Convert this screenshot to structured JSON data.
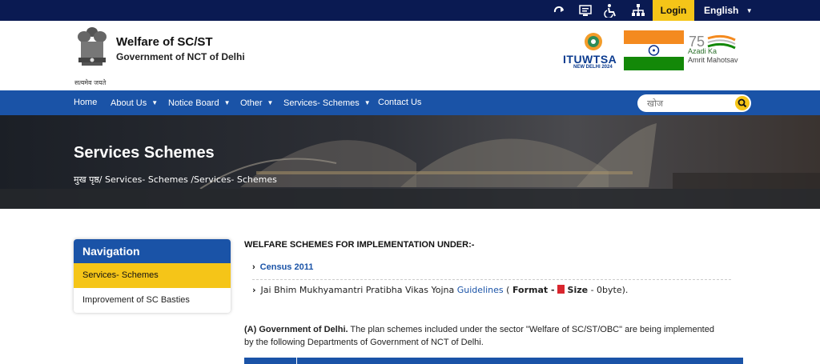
{
  "topbar": {
    "icons": [
      "skip-to-content-icon",
      "screen-reader-icon",
      "accessibility-icon",
      "sitemap-icon"
    ],
    "login_label": "Login",
    "language_label": "English"
  },
  "header": {
    "title": "Welfare of SC/ST",
    "subtitle": "Government of NCT of Delhi",
    "emblem_text": "सत्यमेव जयते",
    "itu_name": "ITUWTSA",
    "itu_sub": "NEW DELHI 2024",
    "azadi_line1": "Azadi Ka",
    "azadi_line2": "Amrit Mahotsav"
  },
  "nav": {
    "items": [
      {
        "label": "Home",
        "dropdown": false
      },
      {
        "label": "About Us",
        "dropdown": true
      },
      {
        "label": "Notice Board",
        "dropdown": true
      },
      {
        "label": "Other",
        "dropdown": true
      },
      {
        "label": "Services- Schemes",
        "dropdown": true
      },
      {
        "label": "Contact Us",
        "dropdown": false
      }
    ],
    "search_placeholder": "खोज"
  },
  "banner": {
    "title": "Services Schemes",
    "breadcrumb": "मुख पृष्ठ/ Services- Schemes /Services- Schemes"
  },
  "sidebar": {
    "heading": "Navigation",
    "items": [
      {
        "label": "Services- Schemes",
        "active": true
      },
      {
        "label": "Improvement of SC Basties",
        "active": false
      }
    ]
  },
  "content": {
    "heading": "WELFARE SCHEMES FOR IMPLEMENTATION UNDER:-",
    "list": [
      {
        "text": "Census 2011"
      },
      {
        "text": "Jai Bhim Mukhyamantri Pratibha Vikas Yojna",
        "link": "Guidelines",
        "format_label": "Format -",
        "size_label": "Size",
        "size_value": "- 0byte)."
      }
    ],
    "para_bold": "(A) Government of Delhi.",
    "para_text": " The plan schemes included under the sector \"Welfare of SC/ST/OBC\" are being implemented by the following Departments of Government of NCT of Delhi."
  },
  "colors": {
    "topbar": "#0a1a52",
    "primary": "#1a53a7",
    "accent": "#f5c518"
  }
}
